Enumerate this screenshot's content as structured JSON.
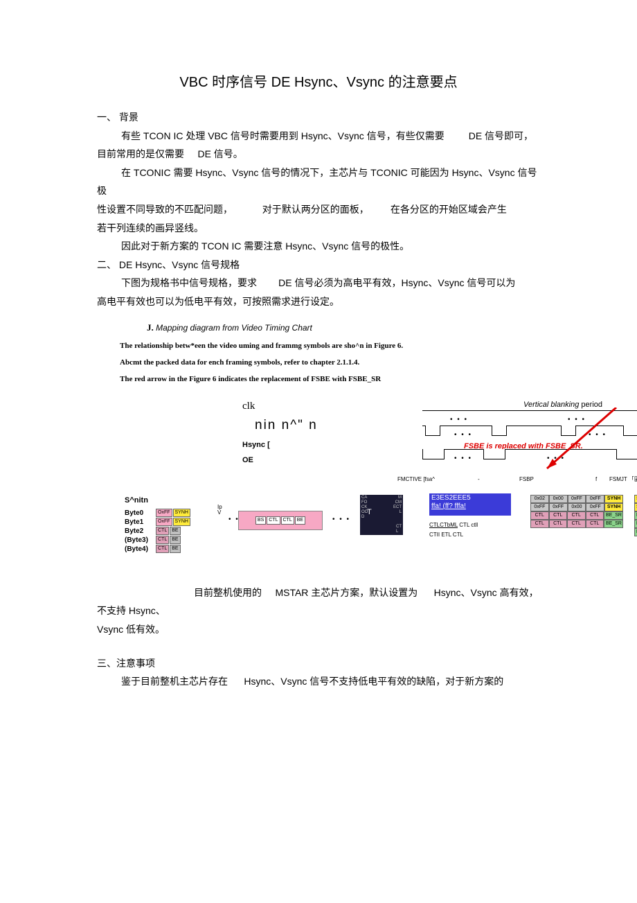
{
  "title": "VBC 时序信号 DE Hsync、Vsync 的注意要点",
  "s1": {
    "heading": "一、 背景",
    "p1a": "有些 TCON IC 处理 VBC 信号时需要用到 Hsync、Vsync 信号，有些仅需要",
    "p1b": "DE 信号即可，",
    "p2a": "目前常用的是仅需要",
    "p2b": "DE 信号。",
    "p3": "在 TCONIC 需要 Hsync、Vsync 信号的情况下，主芯片与 TCONIC 可能因为 Hsync、Vsync 信号极",
    "p4a": "性设置不同导致的不匹配问题，",
    "p4b": "对于默认两分区的面板，",
    "p4c": "在各分区的开始区域会产生",
    "p5": "若干列连续的画异竖线。",
    "p6": "因此对于新方案的 TCON IC 需要注意 Hsync、Vsync 信号的极性。"
  },
  "s2": {
    "heading": "二、 DE Hsync、Vsync 信号规格",
    "p1a": "下图为规格书中信号规格，要求",
    "p1b": "DE 信号必须为高电平有效，Hsync、Vsync 信号可以为",
    "p2": "高电平有效也可以为低电平有效，可按照需求进行设定。"
  },
  "subJ": {
    "label": "J.",
    "title": "Mapping diagram from Video Timing Chart",
    "line1": "The relationship betw*een the video uming and frammg symbols are sho^n in Figure 6.",
    "line2": "Abcmt the packed data for ench framing symbols, refer to chapter 2.1.1.4.",
    "line3": "The red arrow in the Figure 6 indicates the replacement of FSBE with FSBE_SR"
  },
  "diagram": {
    "clk": "clk",
    "nin": "nin  n^\"  n",
    "hsync": "Hsync [",
    "oe": "OE",
    "vblank_a": "Vertical blanking",
    "vblank_b": "period",
    "fsbe_note": "FSBE is replaced with FSBE_SR.",
    "tick1": "FMCTIVE [fsa^",
    "tick2": "-",
    "tick3": "FSBP",
    "tick4": "f",
    "tick5": "FSMJT 「區[fSB",
    "snitn": "S^nitn",
    "byte0": "Byte0",
    "byte1": "Byte1",
    "byte2": "Byte2",
    "byte3": "(Byte3)",
    "byte4": "(Byte4)",
    "cell_oxff": "OxFF",
    "cell_synh": "SYNH",
    "cell_ctl": "CTL",
    "cell_be": "BE",
    "cell_bs": "BS",
    "ip": "Ip",
    "v": "V",
    "mid_text": "CA\nFO\nCK\nOO\nD",
    "mid_text2": "M\nCM\nECT\nL",
    "mid_t": "T",
    "mid_ct": "CT\nL",
    "blue1": "E3ES2EEE5",
    "blue2": "ffa! (ff? fffa!",
    "blue_cap1_u": "CTLCTbML",
    "blue_cap1_r": "CTL ctll",
    "blue_cap2": "CTII ETL CTL",
    "hex_0x02": "0x02",
    "hex_0x00": "0x00",
    "hex_0xff": "0xFF",
    "be_sr": "BE_SR",
    "dots": "• • •"
  },
  "footer": {
    "line1a": "目前整机使用的",
    "line1b": "MSTAR 主芯片方案，默认设置为",
    "line1c": "Hsync、Vsync 高有效，不支持 Hsync、",
    "line2": "Vsync 低有效。"
  },
  "s3": {
    "heading": "三、注意事项",
    "p1a": "鉴于目前整机主芯片存在",
    "p1b": "Hsync、Vsync 信号不支持低电平有效的缺陷，对于新方案的"
  }
}
